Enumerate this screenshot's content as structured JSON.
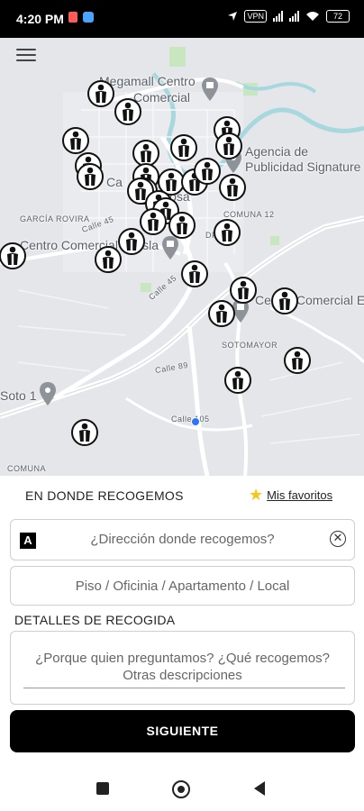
{
  "status_bar": {
    "time": "4:20 PM",
    "vpn": "VPN",
    "battery": "72"
  },
  "map": {
    "labels": {
      "megamall": "Megamall Centro",
      "comercial": "Comercial",
      "agencia1": "Agencia de",
      "agencia2": "Publicidad Signature",
      "garcia": "GARCÍA ROVIRA",
      "calle45": "Calle 45",
      "la_isla": "Centro Comercial La Isla",
      "comuna12": "COMUNA 12",
      "centro_el": "Centro Comercial El",
      "sotomayor": "SOTOMAYOR",
      "calle89": "Calle 89",
      "soto": "Soto 1",
      "calle105": "Calle 105",
      "comuna": "COMUNA",
      "rosa": "Rosa",
      "ca": "Ca",
      "dfre": "DFRE"
    },
    "marker_icon": "person-icon",
    "marker_count": 31
  },
  "sheet": {
    "title": "EN DONDE RECOGEMOS",
    "favorites_label": "Mis favoritos",
    "address_placeholder": "¿Dirección donde recogemos?",
    "address_icon_letter": "A",
    "unit_placeholder": "Piso / Oficinia / Apartamento / Local",
    "details_title": "DETALLES DE RECOGIDA",
    "details_line1": "¿Porque quien preguntamos? ¿Qué recogemos?",
    "details_line2": "Otras descripciones",
    "next_label": "SIGUIENTE"
  },
  "colors": {
    "accent": "#000000",
    "star": "#f5c518",
    "location_dot": "#2d74ff"
  }
}
